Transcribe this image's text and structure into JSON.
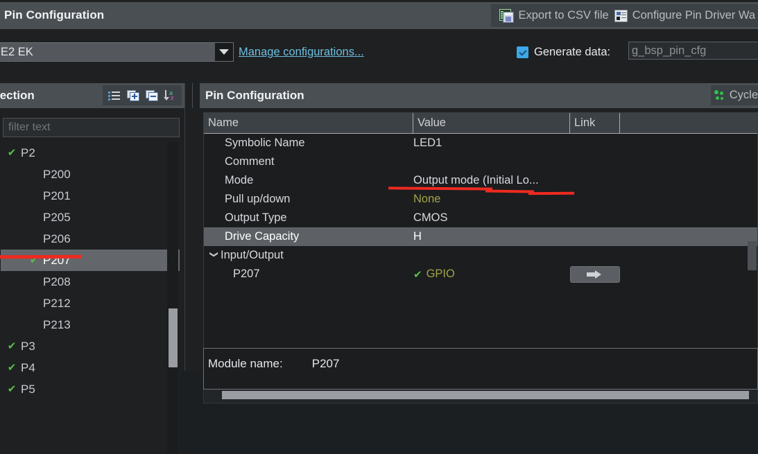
{
  "window": {
    "title": "Pin Configuration",
    "toolbar_actions": [
      {
        "icon": "export-csv-icon",
        "label": "Export to CSV file"
      },
      {
        "icon": "configure-pin-driver-icon",
        "label": "Configure Pin Driver Wa"
      }
    ]
  },
  "config_bar": {
    "board_combo_value": "E2 EK",
    "manage_link": "Manage configurations...",
    "generate_data_label": "Generate data:",
    "generate_data_checked": true,
    "generate_data_value": "g_bsp_pin_cfg"
  },
  "left_panel": {
    "title": "lection",
    "toolbar": [
      {
        "name": "show-list-icon",
        "tooltip": "list"
      },
      {
        "name": "expand-all-icon",
        "tooltip": "expand all"
      },
      {
        "name": "collapse-all-icon",
        "tooltip": "collapse all"
      },
      {
        "name": "sort-az-icon",
        "tooltip": "sort"
      }
    ],
    "filter_placeholder": "filter text",
    "tree": [
      {
        "label": "P2",
        "indent": 0,
        "checked": true,
        "selected": false,
        "expanded": true
      },
      {
        "label": "P200",
        "indent": 1,
        "checked": false,
        "selected": false
      },
      {
        "label": "P201",
        "indent": 1,
        "checked": false,
        "selected": false
      },
      {
        "label": "P205",
        "indent": 1,
        "checked": false,
        "selected": false
      },
      {
        "label": "P206",
        "indent": 1,
        "checked": false,
        "selected": false
      },
      {
        "label": "P207",
        "indent": 1,
        "checked": true,
        "selected": true
      },
      {
        "label": "P208",
        "indent": 1,
        "checked": false,
        "selected": false
      },
      {
        "label": "P212",
        "indent": 1,
        "checked": false,
        "selected": false
      },
      {
        "label": "P213",
        "indent": 1,
        "checked": false,
        "selected": false
      },
      {
        "label": "P3",
        "indent": 0,
        "checked": true,
        "selected": false
      },
      {
        "label": "P4",
        "indent": 0,
        "checked": true,
        "selected": false
      },
      {
        "label": "P5",
        "indent": 0,
        "checked": true,
        "selected": false
      }
    ]
  },
  "main_panel": {
    "title": "Pin Configuration",
    "header_action_label": "Cycle",
    "columns": [
      "Name",
      "Value",
      "Link"
    ],
    "rows": [
      {
        "name": "Symbolic Name",
        "value": "LED1",
        "indent": 1,
        "highlight": false,
        "twisty": "",
        "value_style": "plain",
        "check": false,
        "button": false
      },
      {
        "name": "Comment",
        "value": "",
        "indent": 1,
        "highlight": false,
        "twisty": "",
        "value_style": "plain",
        "check": false,
        "button": false
      },
      {
        "name": "Mode",
        "value": "Output mode (Initial Lo...",
        "indent": 1,
        "highlight": false,
        "twisty": "",
        "value_style": "plain",
        "check": false,
        "button": false
      },
      {
        "name": "Pull up/down",
        "value": "None",
        "indent": 1,
        "highlight": false,
        "twisty": "",
        "value_style": "olive",
        "check": false,
        "button": false
      },
      {
        "name": "Output Type",
        "value": "CMOS",
        "indent": 1,
        "highlight": false,
        "twisty": "",
        "value_style": "plain",
        "check": false,
        "button": false
      },
      {
        "name": "Drive Capacity",
        "value": "H",
        "indent": 1,
        "highlight": true,
        "twisty": "",
        "value_style": "plain",
        "check": false,
        "button": false
      },
      {
        "name": "Input/Output",
        "value": "",
        "indent": 0,
        "highlight": false,
        "twisty": "v",
        "value_style": "plain",
        "check": false,
        "button": false
      },
      {
        "name": "P207",
        "value": "GPIO",
        "indent": 2,
        "highlight": false,
        "twisty": "",
        "value_style": "olive",
        "check": true,
        "button": true
      }
    ],
    "module": {
      "key": "Module name:",
      "value": "P207"
    }
  },
  "annotations": {
    "color": "#ee2a20",
    "marks": [
      "tree-p207-underline",
      "mode-value-underline"
    ]
  }
}
